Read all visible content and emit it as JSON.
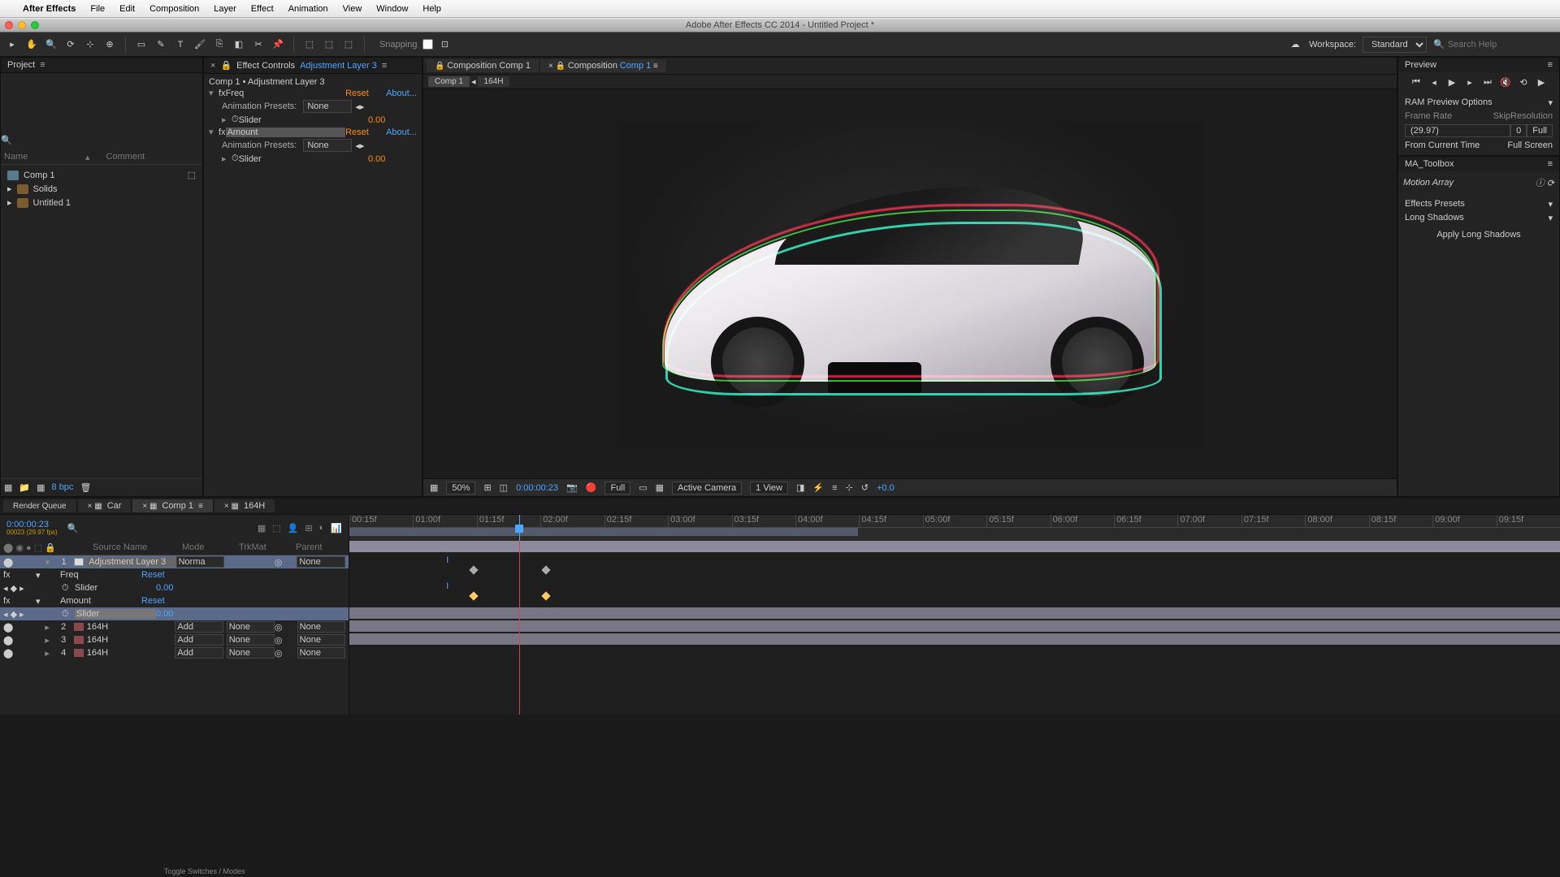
{
  "menubar": {
    "app": "After Effects",
    "items": [
      "File",
      "Edit",
      "Composition",
      "Layer",
      "Effect",
      "Animation",
      "View",
      "Window",
      "Help"
    ]
  },
  "window_title": "Adobe After Effects CC 2014 - Untitled Project *",
  "toolbar": {
    "snapping": "Snapping",
    "workspace_label": "Workspace:",
    "workspace_value": "Standard",
    "search_placeholder": "Search Help"
  },
  "project": {
    "title": "Project",
    "col_name": "Name",
    "col_comment": "Comment",
    "items": [
      {
        "name": "Comp 1",
        "type": "comp"
      },
      {
        "name": "Solids",
        "type": "folder"
      },
      {
        "name": "Untitled 1",
        "type": "folder"
      }
    ],
    "bpc": "8 bpc"
  },
  "effect_controls": {
    "title": "Effect Controls",
    "layer": "Adjustment Layer 3",
    "breadcrumb": "Comp 1 • Adjustment Layer 3",
    "preset_label": "Animation Presets:",
    "preset_value": "None",
    "reset": "Reset",
    "about": "About...",
    "effects": [
      {
        "name": "Freq",
        "slider_label": "Slider",
        "slider_value": "0.00"
      },
      {
        "name": "Amount",
        "slider_label": "Slider",
        "slider_value": "0.00",
        "selected": true
      }
    ]
  },
  "comp_viewer": {
    "tab1": "Composition Comp 1",
    "tab2_prefix": "Composition",
    "tab2_name": "Comp 1",
    "sub1": "Comp 1",
    "sub2": "164H",
    "zoom": "50%",
    "timecode": "0:00:00:23",
    "resolution": "Full",
    "camera": "Active Camera",
    "views": "1 View",
    "exposure": "+0.0"
  },
  "preview": {
    "title": "Preview",
    "ram_options": "RAM Preview Options",
    "frame_rate": "Frame Rate",
    "skip": "Skip",
    "resolution": "Resolution",
    "fr_val": "(29.97)",
    "skip_val": "0",
    "res_val": "Full",
    "from_current": "From Current Time",
    "full_screen": "Full Screen"
  },
  "ma_toolbox": {
    "title": "MA_Toolbox",
    "brand": "Motion Array",
    "sec1": "Effects Presets",
    "sec2": "Long Shadows",
    "btn": "Apply Long Shadows"
  },
  "timeline": {
    "tabs": [
      "Render Queue",
      "Car",
      "Comp 1",
      "164H"
    ],
    "active_tab": 2,
    "timecode": "0:00:00:23",
    "timecode_sub": "00023 (29.97 fps)",
    "ruler": [
      "00:15f",
      "01:00f",
      "01:15f",
      "02:00f",
      "02:15f",
      "03:00f",
      "03:15f",
      "04:00f",
      "04:15f",
      "05:00f",
      "05:15f",
      "06:00f",
      "06:15f",
      "07:00f",
      "07:15f",
      "08:00f",
      "08:15f",
      "09:00f",
      "09:15f"
    ],
    "cols": {
      "source": "Source Name",
      "mode": "Mode",
      "trkmat": "TrkMat",
      "parent": "Parent"
    },
    "toggle": "Toggle Switches / Modes",
    "layers": [
      {
        "num": "1",
        "name": "Adjustment Layer 3",
        "mode": "Norma",
        "trkmat": "",
        "parent": "None",
        "selected": true,
        "adjustment": true
      },
      {
        "num": "2",
        "name": "164H",
        "mode": "Add",
        "trkmat": "None",
        "parent": "None"
      },
      {
        "num": "3",
        "name": "164H",
        "mode": "Add",
        "trkmat": "None",
        "parent": "None"
      },
      {
        "num": "4",
        "name": "164H",
        "mode": "Add",
        "trkmat": "None",
        "parent": "None"
      }
    ],
    "props": [
      {
        "name": "Freq",
        "reset": "Reset"
      },
      {
        "name": "Slider",
        "value": "0.00",
        "indent": 1
      },
      {
        "name": "Amount",
        "reset": "Reset",
        "selected": true
      },
      {
        "name": "Slider",
        "value": "0.00",
        "indent": 1,
        "selected": true
      }
    ]
  }
}
